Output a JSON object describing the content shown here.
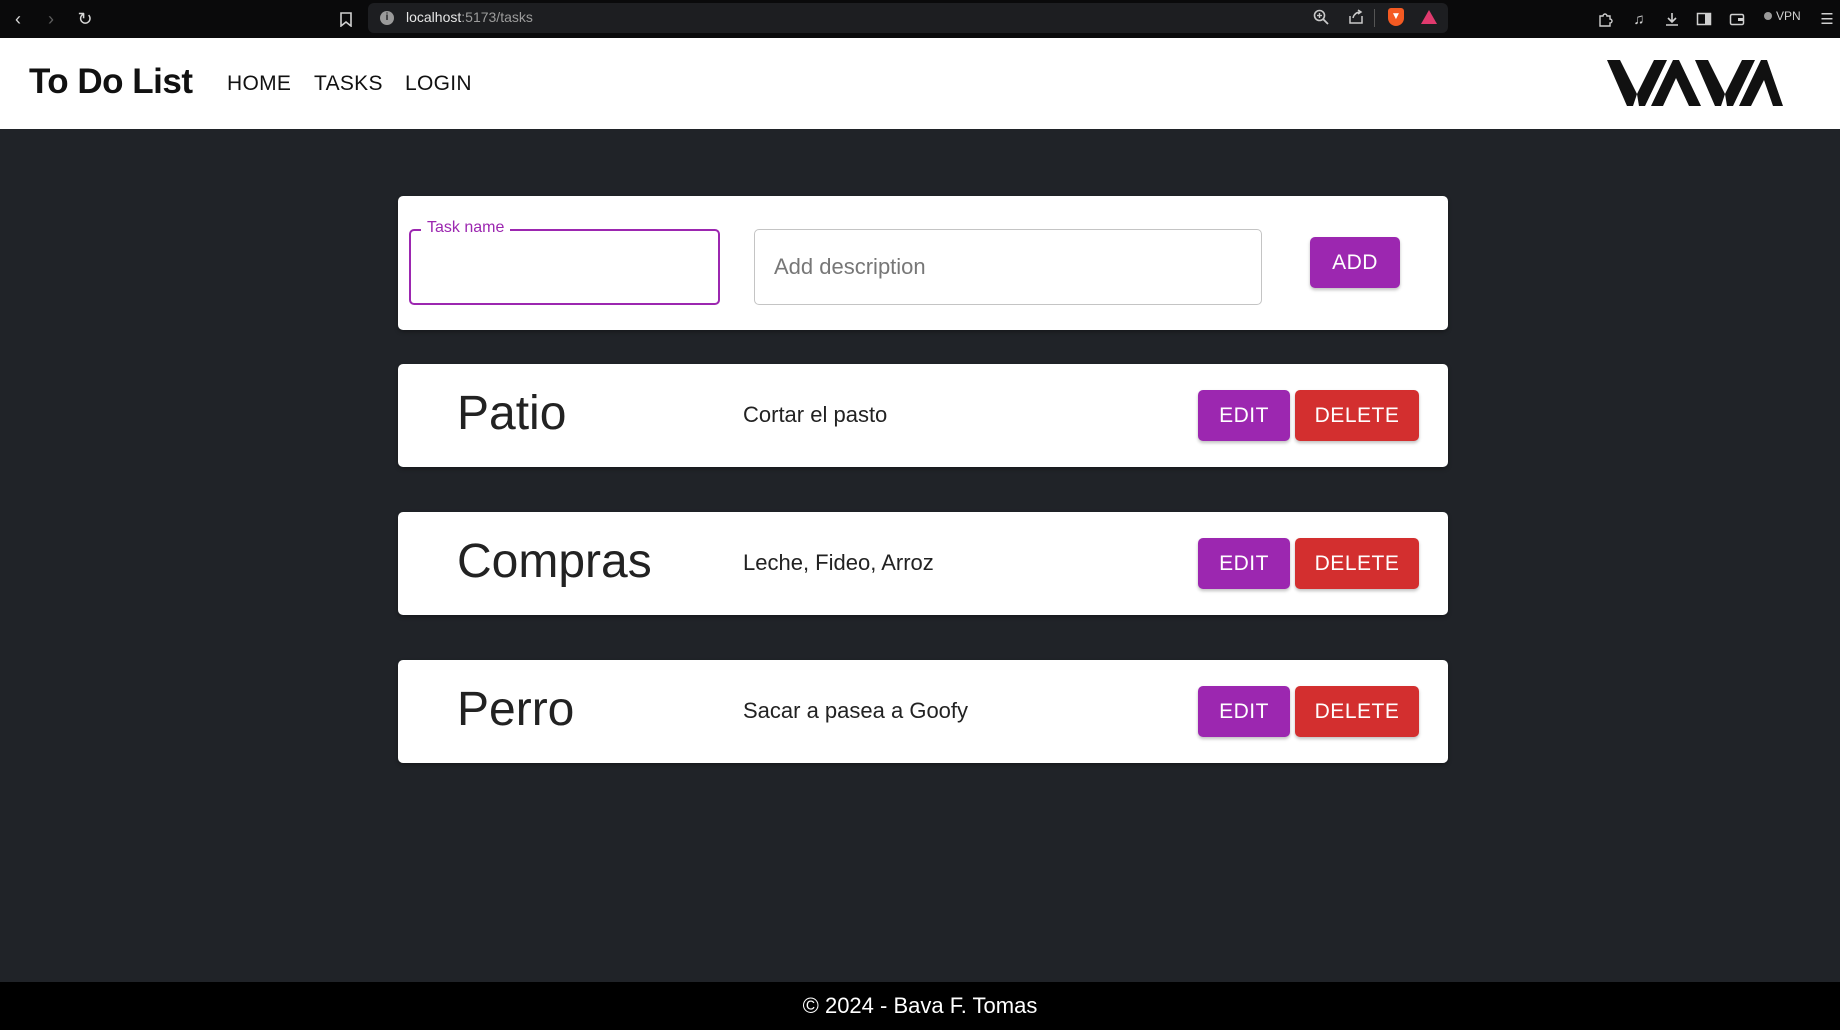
{
  "browser": {
    "url_host": "localhost",
    "url_path": ":5173/tasks",
    "vpn_label": "VPN"
  },
  "header": {
    "brand": "To Do List",
    "nav": [
      "HOME",
      "TASKS",
      "LOGIN"
    ],
    "logo_text": "VAVA"
  },
  "form": {
    "name_label": "Task name",
    "name_value": "",
    "description_placeholder": "Add description",
    "add_label": "ADD"
  },
  "tasks": [
    {
      "title": "Patio",
      "description": "Cortar el pasto",
      "edit_label": "EDIT",
      "delete_label": "DELETE"
    },
    {
      "title": "Compras",
      "description": "Leche, Fideo, Arroz",
      "edit_label": "EDIT",
      "delete_label": "DELETE"
    },
    {
      "title": "Perro",
      "description": "Sacar a pasea a Goofy",
      "edit_label": "EDIT",
      "delete_label": "DELETE"
    }
  ],
  "footer": {
    "text": "© 2024 - Bava F. Tomas"
  },
  "colors": {
    "page_bg": "#202328",
    "primary": "#9c27b0",
    "danger": "#d32f2f",
    "footer_bg": "#000000"
  }
}
